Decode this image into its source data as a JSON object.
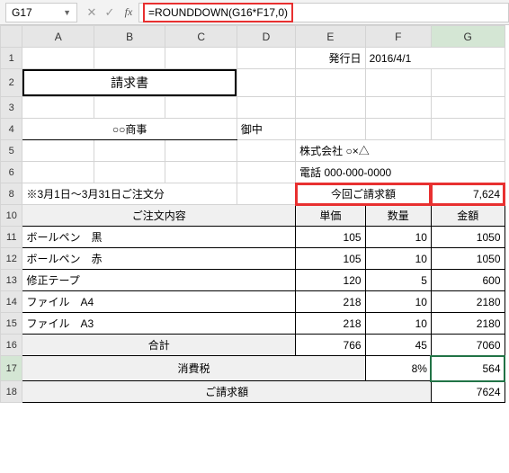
{
  "name_box": "G17",
  "formula": "=ROUNDDOWN(G16*F17,0)",
  "columns": [
    "A",
    "B",
    "C",
    "D",
    "E",
    "F",
    "G"
  ],
  "rows": [
    "1",
    "2",
    "3",
    "4",
    "5",
    "6",
    "8",
    "10",
    "11",
    "12",
    "13",
    "14",
    "15",
    "16",
    "17",
    "18"
  ],
  "header": {
    "issued_label": "発行日",
    "issued_date": "2016/4/1"
  },
  "title": "請求書",
  "vendor": {
    "name": "○○商事",
    "suffix": "御中"
  },
  "company": {
    "name": "株式会社 ○×△",
    "tel_label": "電話",
    "tel": "000-000-0000"
  },
  "period_note": "※3月1日～3月31日ご注文分",
  "invoice_total": {
    "label": "今回ご請求額",
    "value": "7,624"
  },
  "table_head": {
    "order": "ご注文内容",
    "unit": "単価",
    "qty": "数量",
    "amount": "金額"
  },
  "items": [
    {
      "name": "ボールペン　黒",
      "unit": "105",
      "qty": "10",
      "amount": "1050"
    },
    {
      "name": "ボールペン　赤",
      "unit": "105",
      "qty": "10",
      "amount": "1050"
    },
    {
      "name": "修正テープ",
      "unit": "120",
      "qty": "5",
      "amount": "600"
    },
    {
      "name": "ファイル　A4",
      "unit": "218",
      "qty": "10",
      "amount": "2180"
    },
    {
      "name": "ファイル　A3",
      "unit": "218",
      "qty": "10",
      "amount": "2180"
    }
  ],
  "subtotal": {
    "label": "合計",
    "unit": "766",
    "qty": "45",
    "amount": "7060"
  },
  "tax": {
    "label": "消費税",
    "rate": "8%",
    "amount": "564"
  },
  "grand": {
    "label": "ご請求額",
    "amount": "7624"
  }
}
